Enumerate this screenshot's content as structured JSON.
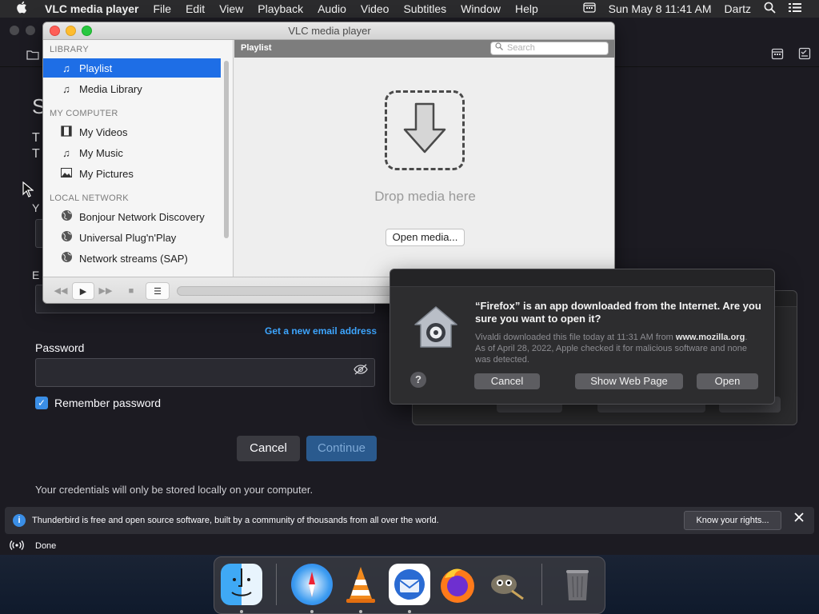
{
  "menubar": {
    "app_name": "VLC media player",
    "menus": [
      "File",
      "Edit",
      "View",
      "Playback",
      "Audio",
      "Video",
      "Subtitles",
      "Window",
      "Help"
    ],
    "clock": "Sun May 8  11:41 AM",
    "user": "Dartz"
  },
  "vlc": {
    "window_title": "VLC media player",
    "sidebar": {
      "sections": [
        {
          "title": "LIBRARY",
          "items": [
            {
              "label": "Playlist",
              "icon": "playlist-icon",
              "selected": true
            },
            {
              "label": "Media Library",
              "icon": "media-library-icon"
            }
          ]
        },
        {
          "title": "MY COMPUTER",
          "items": [
            {
              "label": "My Videos",
              "icon": "film-icon"
            },
            {
              "label": "My Music",
              "icon": "music-note-icon"
            },
            {
              "label": "My Pictures",
              "icon": "picture-icon"
            }
          ]
        },
        {
          "title": "LOCAL NETWORK",
          "items": [
            {
              "label": "Bonjour Network Discovery",
              "icon": "globe-icon"
            },
            {
              "label": "Universal Plug'n'Play",
              "icon": "globe-icon"
            },
            {
              "label": "Network streams (SAP)",
              "icon": "globe-icon"
            }
          ]
        }
      ]
    },
    "main": {
      "header": "Playlist",
      "search_placeholder": "Search",
      "drop_text": "Drop media here",
      "open_media_label": "Open media..."
    }
  },
  "thunderbird": {
    "get_email_link": "Get a new email address",
    "password_label": "Password",
    "remember_label": "Remember password",
    "cancel_label": "Cancel",
    "continue_label": "Continue",
    "credentials_note": "Your credentials will only be stored locally on your computer.",
    "notice_text": "Thunderbird is free and open source software, built by a community of thousands from all over the world.",
    "know_rights_label": "Know your rights...",
    "status_text": "Done",
    "partial_letters": [
      "S",
      "T",
      "T",
      "Y",
      "E"
    ]
  },
  "gatekeeper": {
    "title": "“Firefox” is an app downloaded from the Internet. Are you sure you want to open it?",
    "body_prefix": "Vivaldi downloaded this file today at 11:31 AM from",
    "body_domain": "www.mozilla.org",
    "body_suffix": ". As of April 28, 2022, Apple checked it for malicious software and none was detected.",
    "help_label": "?",
    "cancel_label": "Cancel",
    "show_web_page_label": "Show Web Page",
    "open_label": "Open"
  },
  "dock": {
    "apps": [
      "Finder",
      "Safari",
      "VLC",
      "Thunderbird",
      "Firefox",
      "GIMP",
      "Trash"
    ]
  },
  "colors": {
    "accent": "#1e6ee6",
    "tb_link": "#3ea6ff",
    "tb_background": "#1c1b22"
  }
}
